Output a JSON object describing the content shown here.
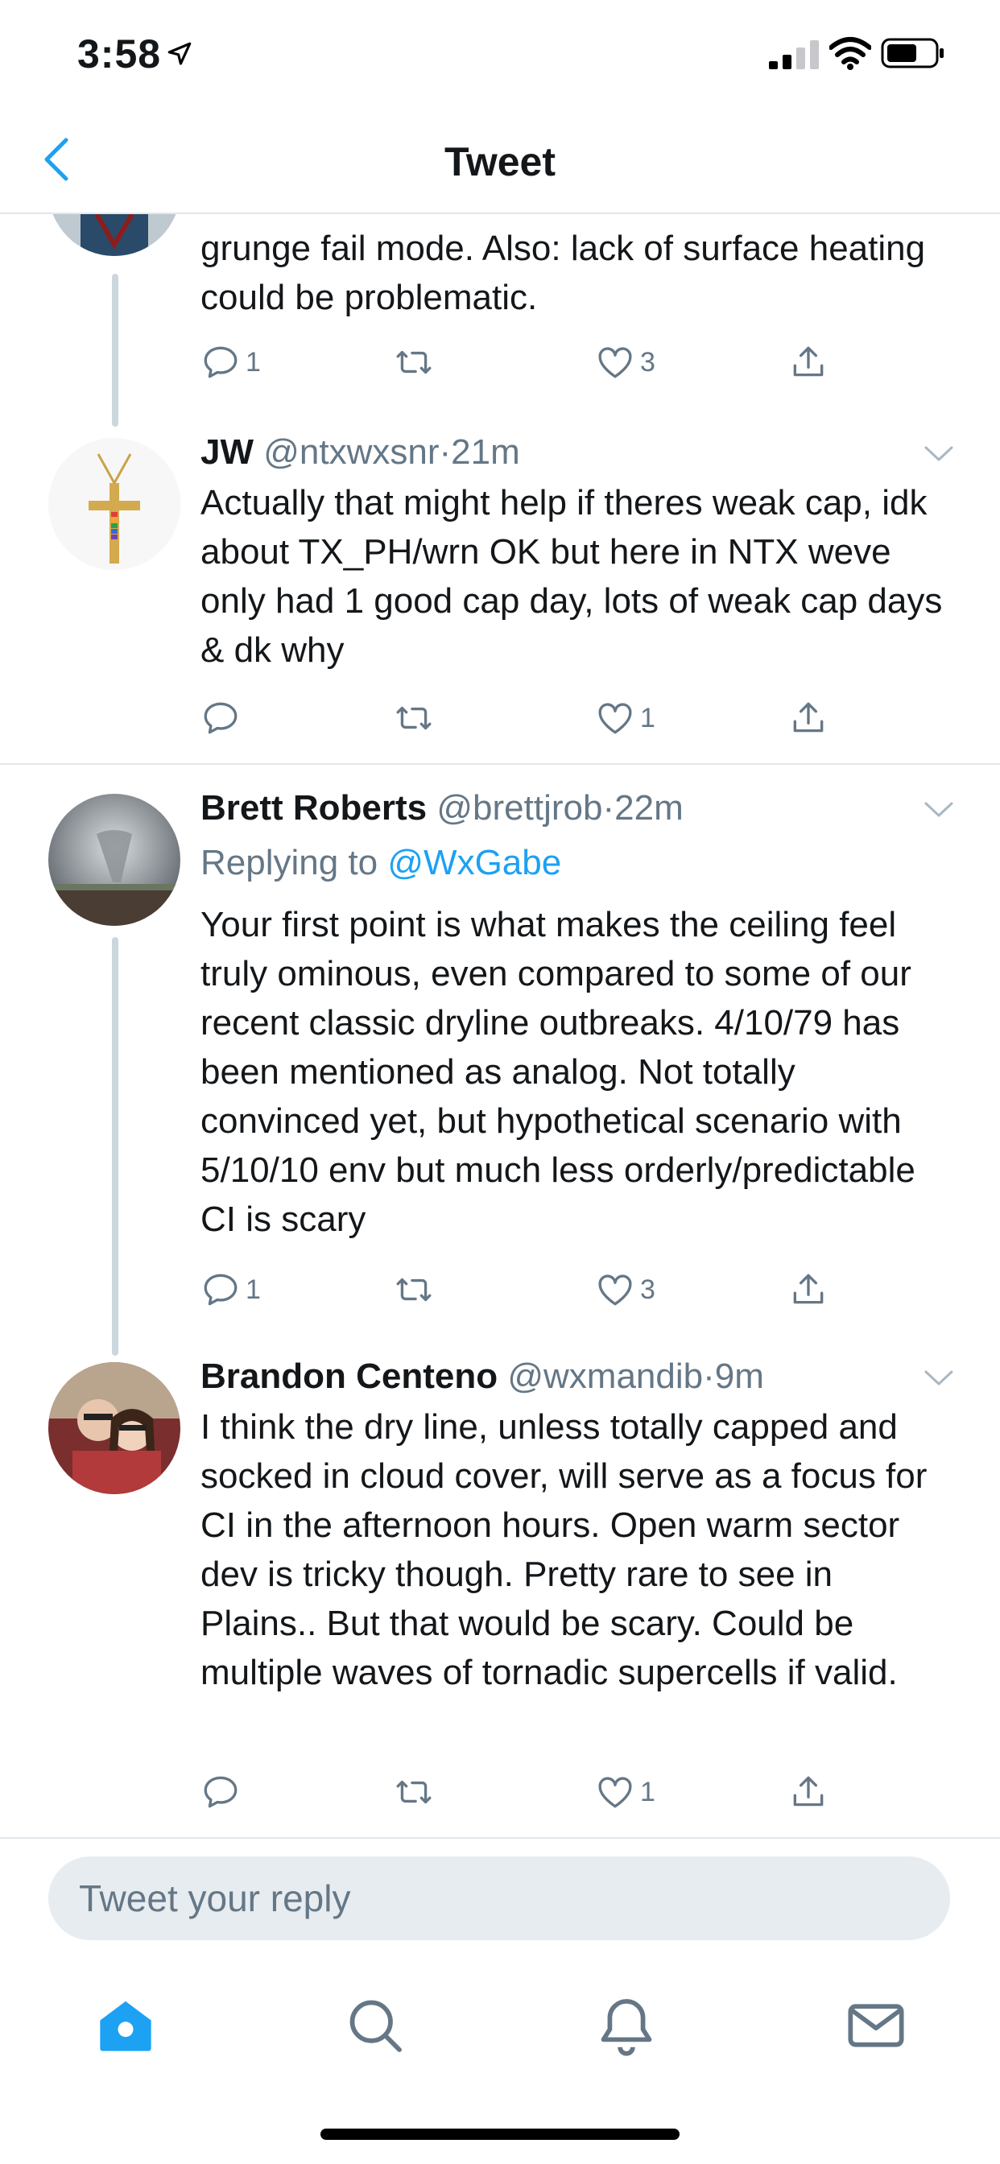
{
  "status_bar": {
    "time": "3:58"
  },
  "nav": {
    "title": "Tweet"
  },
  "tweets": [
    {
      "text": "grunge fail mode. Also: lack of surface heating could be problematic.",
      "replies": "1",
      "likes": "3"
    },
    {
      "name": "JW",
      "handle": "@ntxwxsnr",
      "dot": "·",
      "time": "21m",
      "text": "Actually that might help if theres weak cap, idk about TX_PH/wrn OK but here in NTX weve only had 1 good cap day, lots of weak cap days & dk why",
      "likes": "1"
    },
    {
      "name": "Brett Roberts",
      "handle": "@brettjrob",
      "dot": "·",
      "time": "22m",
      "replying_prefix": "Replying to",
      "replying_to": "@WxGabe",
      "text": "Your first point is what makes the ceiling feel truly ominous, even compared to some of our recent classic dryline outbreaks. 4/10/79 has been mentioned as analog. Not totally convinced yet, but hypothetical scenario with 5/10/10 env but much less orderly/predictable CI is scary",
      "replies": "1",
      "likes": "3"
    },
    {
      "name": "Brandon Centeno",
      "handle": "@wxmandib",
      "dot": "·",
      "time": "9m",
      "text": "I think the dry line, unless totally capped and socked in cloud cover, will serve as a focus for CI in the afternoon hours. Open warm sector dev is tricky though. Pretty rare to see in Plains.. But that would be scary. Could be multiple waves of tornadic supercells if valid.",
      "likes": "1"
    }
  ],
  "reply_bar": {
    "placeholder": "Tweet your reply"
  },
  "tab_bar": {
    "icons": [
      "home-icon",
      "search-icon",
      "notifications-icon",
      "messages-icon"
    ]
  },
  "colors": {
    "accent": "#1da1f2",
    "muted": "#657786",
    "text": "#14171a",
    "divider": "#e1e8ed",
    "thread_line": "#ccd6dd"
  }
}
